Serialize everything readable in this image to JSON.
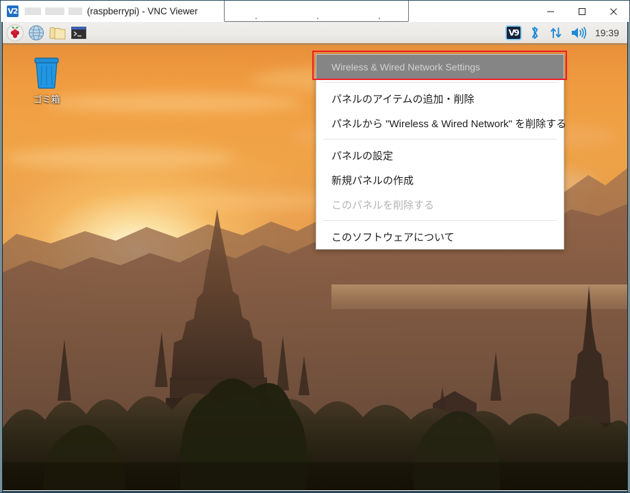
{
  "window": {
    "title": "(raspberrypi) - VNC Viewer",
    "app_icon": "vnc-logo-icon",
    "redacted_host": "",
    "controls": {
      "minimize": "minimize-icon",
      "maximize": "maximize-icon",
      "close": "close-icon"
    }
  },
  "panel": {
    "launchers": [
      {
        "name": "raspberry-pi-menu",
        "icon": "raspberry-icon",
        "label": ""
      },
      {
        "name": "web-browser",
        "icon": "globe-icon",
        "label": ""
      },
      {
        "name": "file-manager",
        "icon": "folder-icon",
        "label": ""
      },
      {
        "name": "terminal",
        "icon": "terminal-icon",
        "label": ""
      }
    ],
    "tray": [
      {
        "name": "vnc-server",
        "icon": "vnc-icon",
        "glyph": "V9",
        "selected": true
      },
      {
        "name": "bluetooth",
        "icon": "bluetooth-icon",
        "selected": false
      },
      {
        "name": "wireless-wired-network",
        "icon": "network-updown-icon",
        "selected": false
      },
      {
        "name": "volume",
        "icon": "speaker-icon",
        "selected": false
      }
    ],
    "clock": "19:39"
  },
  "desktop": {
    "icons": [
      {
        "name": "trash",
        "icon": "trash-bin-icon",
        "label": "ゴミ箱"
      }
    ],
    "wallpaper": "bagan-sunset-temples"
  },
  "context_menu": {
    "items": [
      {
        "label": "Wireless & Wired Network Settings",
        "state": "selected",
        "name": "wireless-wired-network-settings"
      },
      {
        "type": "separator"
      },
      {
        "label": "パネルのアイテムの追加・削除",
        "state": "normal",
        "name": "add-remove-panel-items"
      },
      {
        "label": "パネルから \"Wireless & Wired Network\" を削除する",
        "state": "normal",
        "name": "remove-network-from-panel"
      },
      {
        "type": "separator"
      },
      {
        "label": "パネルの設定",
        "state": "normal",
        "name": "panel-settings"
      },
      {
        "label": "新規パネルの作成",
        "state": "normal",
        "name": "create-new-panel"
      },
      {
        "label": "このパネルを削除する",
        "state": "disabled",
        "name": "delete-this-panel"
      },
      {
        "type": "separator"
      },
      {
        "label": "このソフトウェアについて",
        "state": "normal",
        "name": "about-this-software"
      }
    ]
  },
  "annotation": {
    "highlight_color": "#ee1c25",
    "target": "wireless-wired-network-settings"
  }
}
